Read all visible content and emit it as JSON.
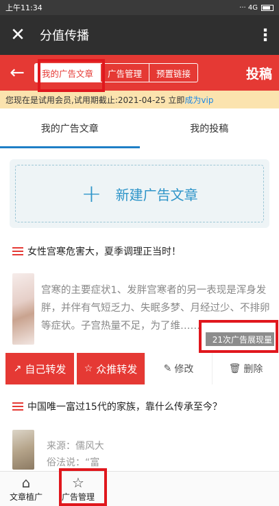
{
  "status_bar": {
    "time": "上午11:34",
    "indicators": "··· 4G"
  },
  "title_bar": {
    "close_icon": "close-icon",
    "title": "分值传播",
    "more_icon": "more-vertical-icon"
  },
  "nav": {
    "back_icon": "back-arrow-icon",
    "tabs": [
      {
        "label": "我的广告文章",
        "active": true
      },
      {
        "label": "广告管理",
        "active": false
      },
      {
        "label": "预置链接",
        "active": false
      }
    ],
    "publish_label": "投稿"
  },
  "notice": {
    "text": "您现在是试用会员,试用期截止:2021-04-25 立即",
    "link": "成为vip"
  },
  "sub_tabs": [
    {
      "label": "我的广告文章",
      "active": true
    },
    {
      "label": "我的投稿",
      "active": false
    }
  ],
  "new_article": {
    "icon": "plus-icon",
    "label": "新建广告文章"
  },
  "articles": [
    {
      "title": "女性宫寒危害大，夏季调理正当时！",
      "excerpt": "宫寒的主要症状1、发胖宫寒者的另一表现是浑身发胖，并伴有气短乏力、失眠多梦、月经过少、不排卵等症状。子宫热量不足，为了维……",
      "views_badge": "21次广告展现量"
    },
    {
      "title": "中国唯一富过15代的家族，靠什么传承至今？",
      "excerpt": "来源：儒风大",
      "excerpt_line2": "俗法说：“富"
    }
  ],
  "actions": {
    "forward_self": "自己转发",
    "crowd_forward": "众推转发",
    "edit": "修改",
    "delete": "删除"
  },
  "bottom_nav": [
    {
      "label": "文章植广",
      "icon": "home-icon"
    },
    {
      "label": "广告管理",
      "icon": "star-icon"
    }
  ],
  "colors": {
    "brand_red": "#e53934",
    "accent_blue": "#1e7fc6",
    "highlight_red": "#e0171d"
  }
}
